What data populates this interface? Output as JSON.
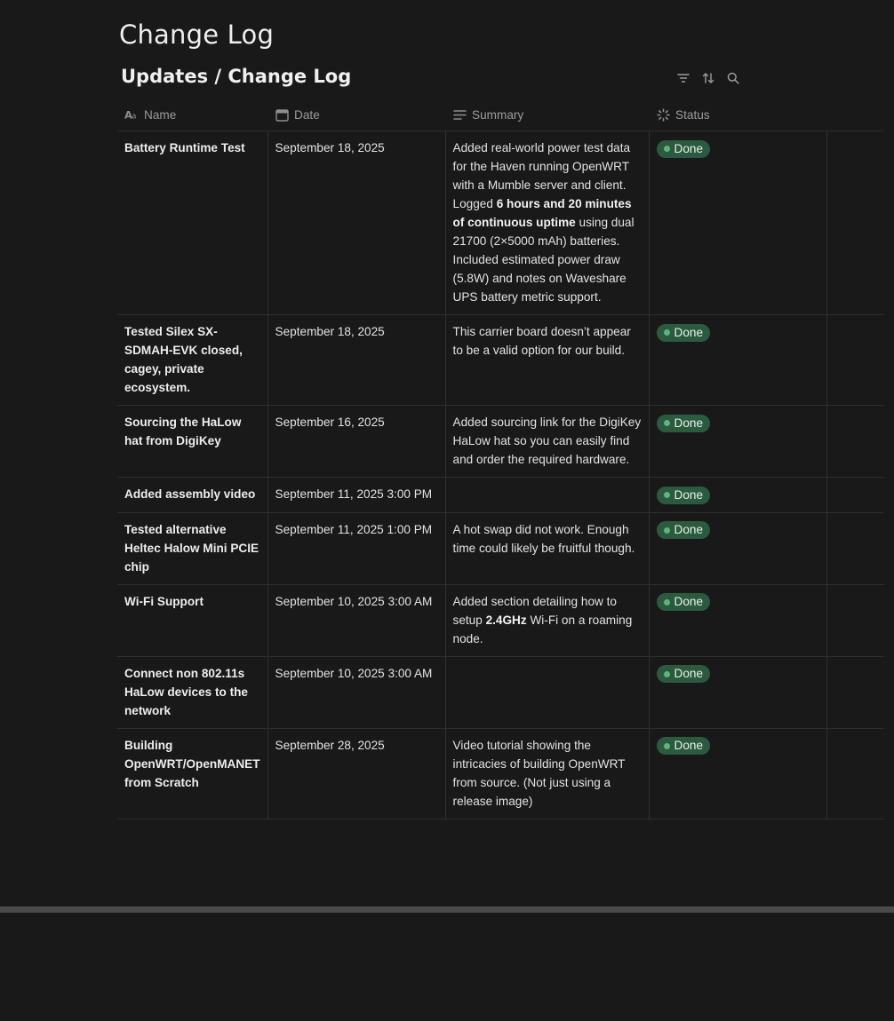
{
  "page": {
    "title": "Change Log"
  },
  "database": {
    "title": "Updates / Change Log",
    "toolbar": {
      "filter_icon": "filter-icon",
      "sort_icon": "sort-icon",
      "search_icon": "search-icon"
    },
    "columns": [
      {
        "label": "Name",
        "icon": "text-aa-icon"
      },
      {
        "label": "Date",
        "icon": "calendar-icon"
      },
      {
        "label": "Summary",
        "icon": "text-lines-icon"
      },
      {
        "label": "Status",
        "icon": "status-spinner-icon"
      }
    ],
    "status_color": "#2b5a3f",
    "status_dot_color": "#5db47c",
    "rows": [
      {
        "name": "Battery Runtime Test",
        "date": "September 18, 2025",
        "summary_parts": [
          {
            "text": "Added real-world power test data for the Haven running OpenWRT with a Mumble server and client. Logged ",
            "bold": false
          },
          {
            "text": "6 hours and 20 minutes of continuous uptime",
            "bold": true
          },
          {
            "text": " using dual 21700 (2×5000 mAh) batteries. Included estimated power draw (5.8W) and notes on Waveshare UPS battery metric support.",
            "bold": false
          }
        ],
        "status": "Done"
      },
      {
        "name": "Tested Silex SX-SDMAH-EVK closed, cagey, private ecosystem.",
        "date": "September 18, 2025",
        "summary_parts": [
          {
            "text": "This carrier board doesn’t appear to be a valid option for our build.",
            "bold": false
          }
        ],
        "status": "Done"
      },
      {
        "name": "Sourcing the HaLow hat from DigiKey",
        "date": "September 16, 2025",
        "summary_parts": [
          {
            "text": "Added sourcing link for the DigiKey HaLow hat so you can easily find and order the required hardware.",
            "bold": false
          }
        ],
        "status": "Done"
      },
      {
        "name": "Added assembly video",
        "date": "September 11, 2025 3:00 PM",
        "summary_parts": [],
        "status": "Done"
      },
      {
        "name": "Tested alternative Heltec Halow Mini PCIE chip",
        "date": "September 11, 2025 1:00 PM",
        "summary_parts": [
          {
            "text": "A hot swap did not work. Enough time could likely be fruitful though.",
            "bold": false
          }
        ],
        "status": "Done"
      },
      {
        "name": "Wi-Fi Support",
        "date": "September 10, 2025 3:00 AM",
        "summary_parts": [
          {
            "text": "Added section detailing how to setup ",
            "bold": false
          },
          {
            "text": "2.4GHz",
            "bold": true
          },
          {
            "text": " Wi-Fi on a roaming node.",
            "bold": false
          }
        ],
        "status": "Done"
      },
      {
        "name": "Connect non 802.11s HaLow devices to the network",
        "date": "September 10, 2025 3:00 AM",
        "summary_parts": [],
        "status": "Done"
      },
      {
        "name": "Building OpenWRT/OpenMANET from Scratch",
        "date": "September 28, 2025",
        "summary_parts": [
          {
            "text": "Video tutorial showing the intricacies of building OpenWRT from source. (Not just using a release image)",
            "bold": false
          }
        ],
        "status": "Done"
      }
    ]
  }
}
